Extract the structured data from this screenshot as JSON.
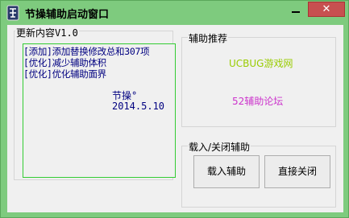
{
  "window": {
    "title": "节操辅助启动窗口",
    "minimize_label": "",
    "close_label": "✕",
    "icon": "app-badge-icon"
  },
  "updates": {
    "group_label": "更新内容V1.0",
    "lines": [
      "[添加]添加替换修改总和307项",
      "[优化]减少辅助体积",
      "[优化]优化辅助面界"
    ],
    "author": "节操°",
    "date": "2014.5.10",
    "text_color": "#000080",
    "border_color": "#33cc33"
  },
  "recommend": {
    "group_label": "辅助推荐",
    "links": [
      {
        "label": "UCBUG游戏网",
        "color": "#99cc00"
      },
      {
        "label": "52辅助论坛",
        "color": "#cc33cc"
      }
    ]
  },
  "actions": {
    "group_label": "载入/关闭辅助",
    "load_label": "载入辅助",
    "close_label": "直接关闭"
  },
  "colors": {
    "title_bar": "#7ecb7e",
    "close_button": "#c75050",
    "client_bg": "#f0f0f0"
  }
}
